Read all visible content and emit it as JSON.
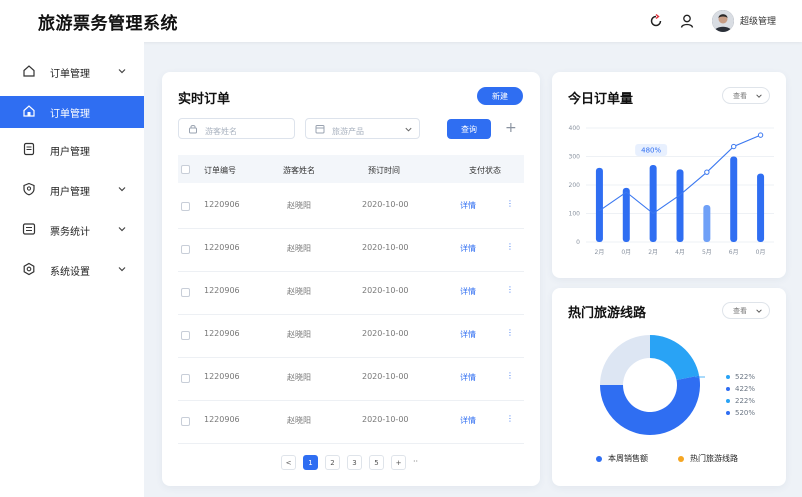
{
  "header": {
    "title": "旅游票务管理系统",
    "username": "超级管理"
  },
  "sidebar": {
    "items": [
      {
        "label": "订单管理"
      },
      {
        "label": "订单管理"
      },
      {
        "label": "用户管理"
      },
      {
        "label": "用户管理"
      },
      {
        "label": "票务统计"
      },
      {
        "label": "系统设置"
      }
    ]
  },
  "orders": {
    "title": "实时订单",
    "top_button": "新建",
    "search_placeholder": "游客姓名",
    "product_placeholder": "旅游产品",
    "search_button": "查询",
    "add_symbol": "+",
    "columns": [
      "订单编号",
      "游客姓名",
      "预订时间",
      "支付状态"
    ],
    "rows": [
      {
        "id": "1220906",
        "name": "赵晓阳",
        "time": "2020-10-00",
        "action": "详情",
        "more": "⋮"
      },
      {
        "id": "1220906",
        "name": "赵晓阳",
        "time": "2020-10-00",
        "action": "详情",
        "more": "⋮"
      },
      {
        "id": "1220906",
        "name": "赵晓阳",
        "time": "2020-10-00",
        "action": "详情",
        "more": "⋮"
      },
      {
        "id": "1220906",
        "name": "赵晓阳",
        "time": "2020-10-00",
        "action": "详情",
        "more": "⋮"
      },
      {
        "id": "1220906",
        "name": "赵晓阳",
        "time": "2020-10-00",
        "action": "详情",
        "more": "⋮"
      },
      {
        "id": "1220906",
        "name": "赵晓阳",
        "time": "2020-10-00",
        "action": "详情",
        "more": "⋮"
      }
    ],
    "pagination": {
      "prev": "<",
      "pages": [
        "1",
        "2",
        "3",
        "5"
      ],
      "next": "+",
      "more": "··"
    }
  },
  "daily": {
    "title": "今日订单量",
    "select": "查看",
    "badge": "480%",
    "chart_data": {
      "type": "bar",
      "categories": [
        "2月",
        "0月",
        "2月",
        "4月",
        "5月",
        "6月",
        "0月"
      ],
      "values": [
        260,
        190,
        270,
        255,
        130,
        300,
        240
      ],
      "line_values": [
        110,
        175,
        100,
        165,
        245,
        335,
        375
      ],
      "yticks": [
        "0",
        "100",
        "200",
        "300",
        "400"
      ],
      "ylim": [
        0,
        400
      ]
    }
  },
  "routes": {
    "title": "热门旅游线路",
    "select": "查看",
    "chart_data": {
      "type": "pie",
      "slices": [
        {
          "value": 22,
          "color": "#29a3f5"
        },
        {
          "value": 53,
          "color": "#2f6ef2"
        },
        {
          "value": 25,
          "color": "#dde6f3"
        }
      ],
      "labels": [
        {
          "text": "522%",
          "color": "#29a3f5"
        },
        {
          "text": "422%",
          "color": "#2f6ef2"
        },
        {
          "text": "222%",
          "color": "#29a3f5"
        },
        {
          "text": "520%",
          "color": "#2f6ef2"
        }
      ]
    },
    "legend": [
      {
        "label": "本周销售额",
        "color": "#2f6ef2"
      },
      {
        "label": "热门旅游线路",
        "color": "#f5a623"
      }
    ]
  }
}
